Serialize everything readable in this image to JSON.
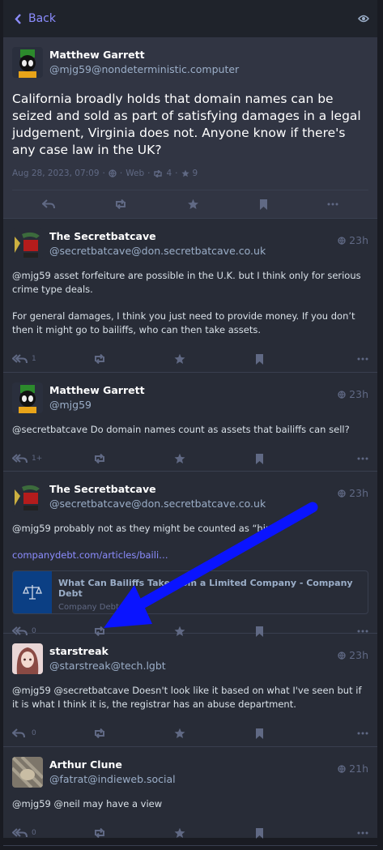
{
  "header": {
    "back_label": "Back",
    "eye_icon": "eye-icon"
  },
  "main_status": {
    "display_name": "Matthew Garrett",
    "username": "@mjg59@nondeterministic.computer",
    "text": "California broadly holds that domain names can be seized and sold as part of satisfying damages in a legal judgement, Virginia does not. Anyone know if there's any case law in the UK?",
    "date": "Aug 28, 2023, 07:09",
    "sep": "·",
    "visibility": "Web",
    "boosts": "4",
    "favourites": "9"
  },
  "replies": [
    {
      "display_name": "The Secretbatcave",
      "username": "@secretbatcave@don.secretbatcave.co.uk",
      "time": "23h",
      "paragraphs": [
        "@mjg59 asset forfeiture are possible in the U.K. but I think only for serious crime type deals.",
        "For general damages, I think you just need to provide money. If you don’t then it might go to bailiffs, who can then take assets."
      ],
      "reply_count": "1"
    },
    {
      "display_name": "Matthew Garrett",
      "username": "@mjg59",
      "time": "23h",
      "paragraphs": [
        "@secretbatcave Do domain names count as assets that bailiffs can sell?"
      ],
      "reply_count": "1+"
    },
    {
      "display_name": "The Secretbatcave",
      "username": "@secretbatcave@don.secretbatcave.co.uk",
      "time": "23h",
      "paragraphs": [
        "@mjg59 probably not as they might be counted as “hired”"
      ],
      "link": "companydebt.com/articles/baili…",
      "card_title": "What Can Bailiffs Take from a Limited Company - Company Debt",
      "card_host": "Company Debt Ltd",
      "reply_count": "0"
    },
    {
      "display_name": "starstreak",
      "username": "@starstreak@tech.lgbt",
      "time": "23h",
      "paragraphs": [
        "@mjg59 @secretbatcave Doesn't look like it based on what I've seen but if it is what I think it is, the registrar has an abuse department."
      ],
      "reply_count": "0"
    },
    {
      "display_name": "Arthur Clune",
      "username": "@fatrat@indieweb.social",
      "time": "21h",
      "paragraphs": [
        "@mjg59 @neil may have a view"
      ],
      "reply_count": "0"
    }
  ],
  "colors": {
    "accent": "#8c8dff",
    "background": "#282c37",
    "arrow": "#0a14ff"
  }
}
